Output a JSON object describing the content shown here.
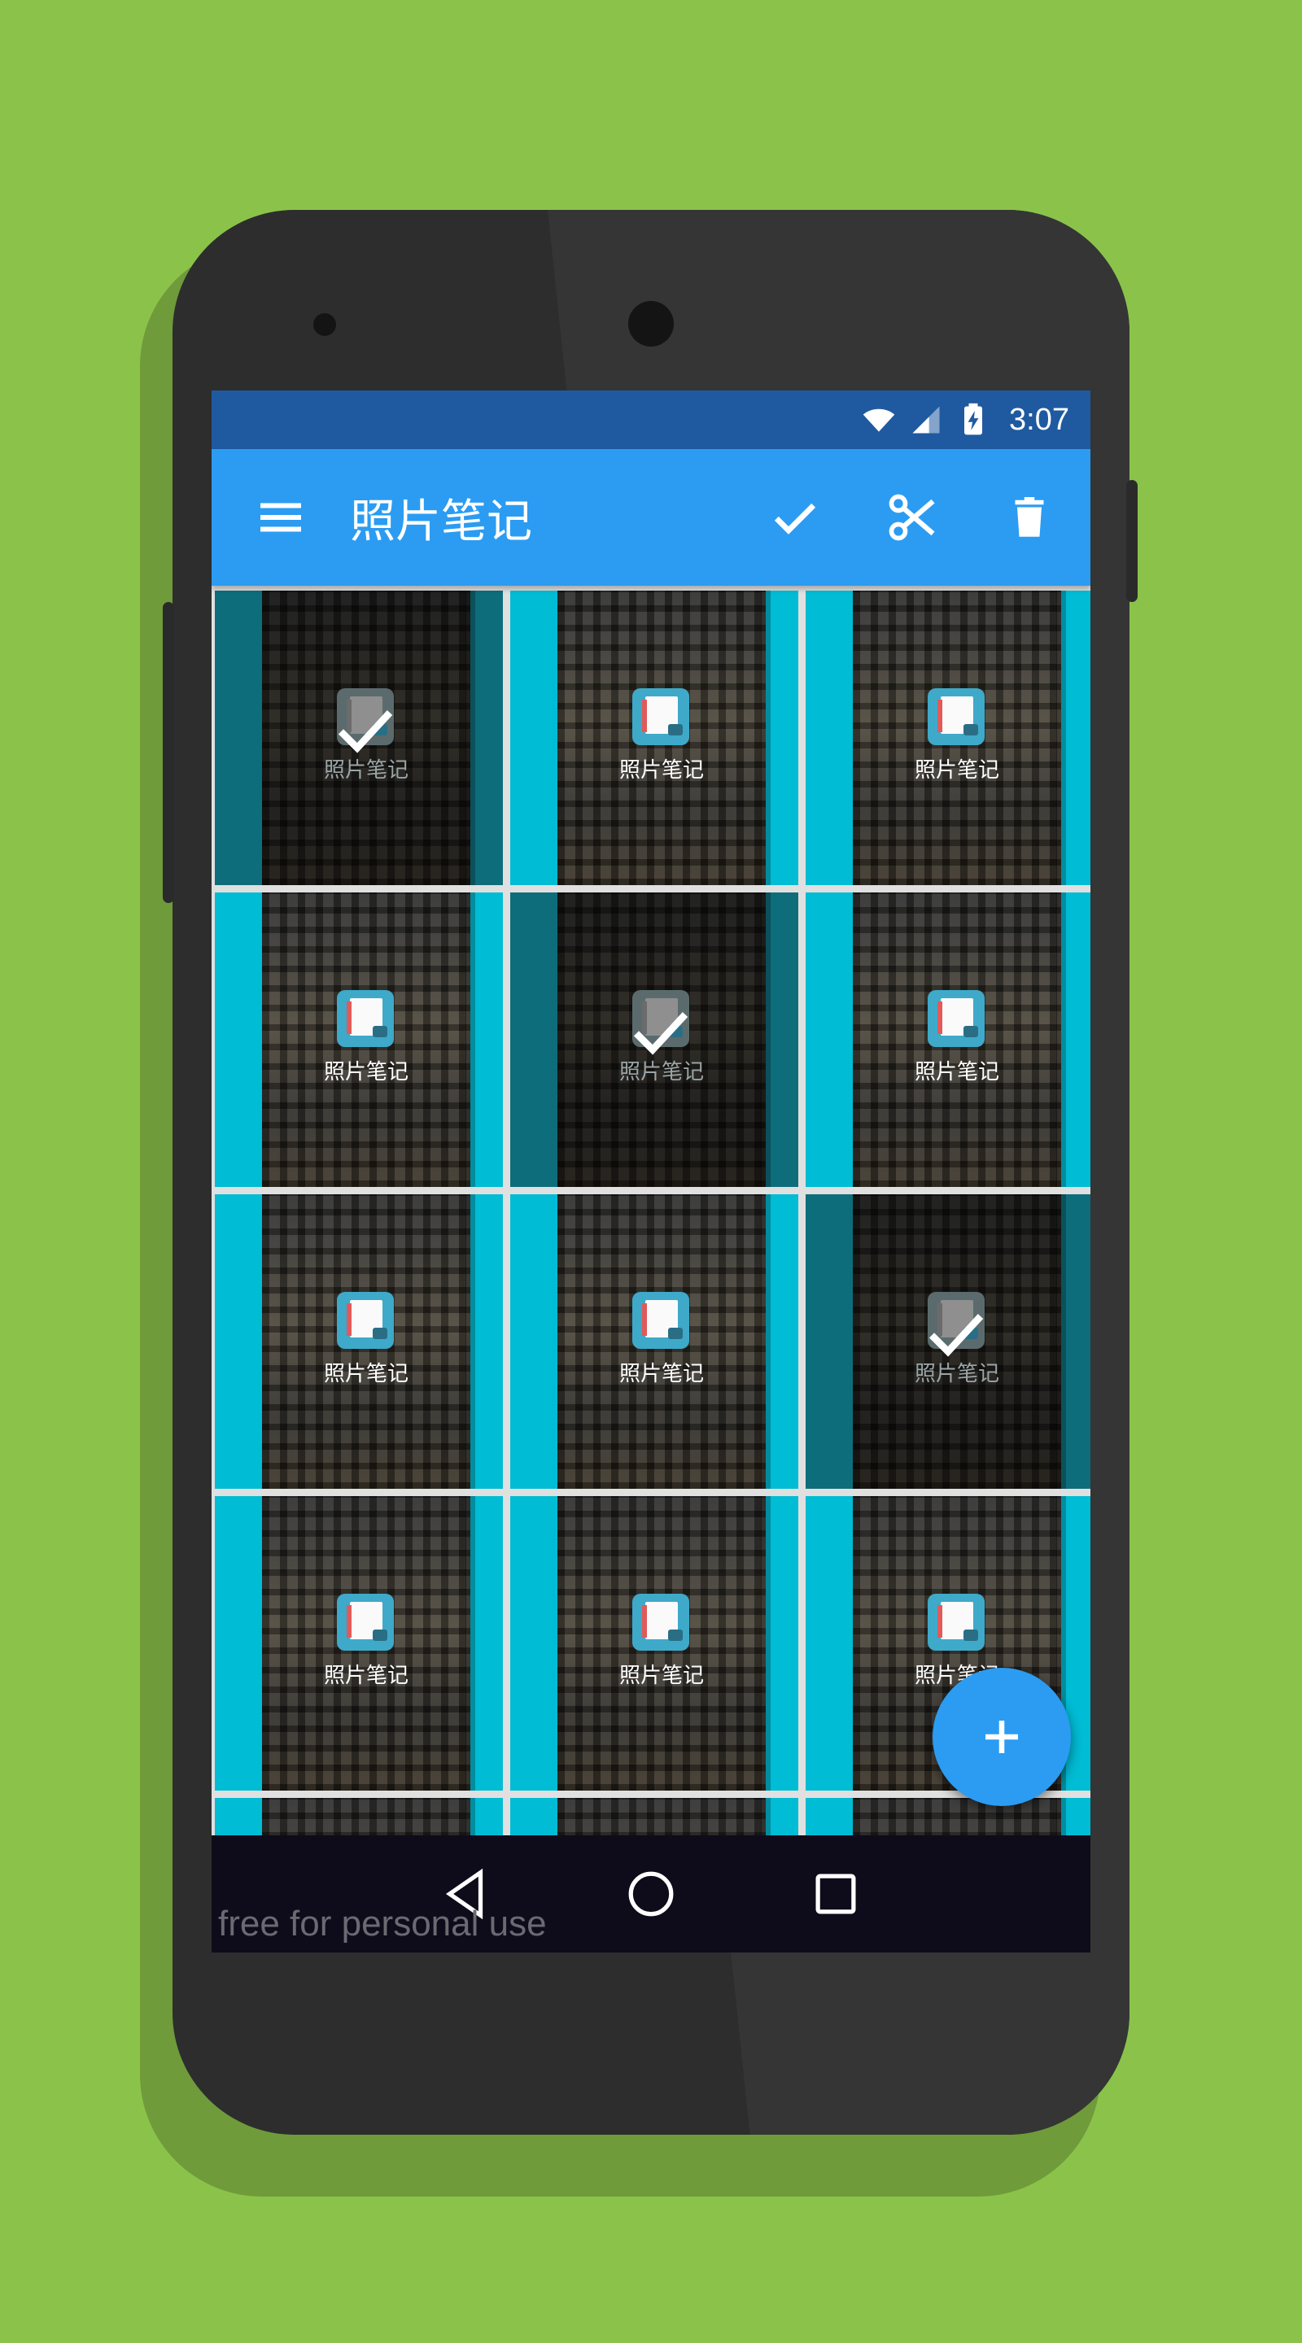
{
  "status_bar": {
    "time": "3:07",
    "icons": [
      "wifi-icon",
      "cell-signal-icon",
      "battery-charging-icon"
    ]
  },
  "toolbar": {
    "title": "照片笔记",
    "menu_icon": "menu-icon",
    "actions": [
      "check-icon",
      "scissors-icon",
      "trash-icon"
    ]
  },
  "grid": {
    "item_label": "照片笔记",
    "items": [
      {
        "label": "照片笔记",
        "selected": true
      },
      {
        "label": "照片笔记",
        "selected": false
      },
      {
        "label": "照片笔记",
        "selected": false
      },
      {
        "label": "照片笔记",
        "selected": false
      },
      {
        "label": "照片笔记",
        "selected": true
      },
      {
        "label": "照片笔记",
        "selected": false
      },
      {
        "label": "照片笔记",
        "selected": false
      },
      {
        "label": "照片笔记",
        "selected": false
      },
      {
        "label": "照片笔记",
        "selected": true
      },
      {
        "label": "照片笔记",
        "selected": false
      },
      {
        "label": "照片笔记",
        "selected": false
      },
      {
        "label": "照片笔记",
        "selected": false
      },
      {
        "label": "",
        "selected": false
      },
      {
        "label": "",
        "selected": false
      },
      {
        "label": "",
        "selected": false
      }
    ]
  },
  "fab": {
    "icon": "plus-icon",
    "label": "+"
  },
  "nav_bar": {
    "buttons": [
      "back-icon",
      "home-icon",
      "recents-icon"
    ]
  },
  "watermark": "free for personal use",
  "colors": {
    "background": "#8bc34a",
    "toolbar": "#2b9cf2",
    "status_bar": "#1f5aa0",
    "cell": "#00bcd4",
    "cell_selected": "#0e6d7a",
    "fab": "#2b9cf2"
  }
}
